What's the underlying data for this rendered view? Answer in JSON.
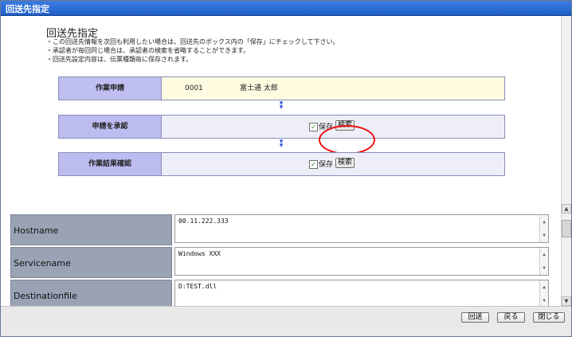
{
  "window": {
    "title": "回送先指定"
  },
  "main": {
    "heading": "回送先指定",
    "notes": [
      "・この回送先情報を次回も利用したい場合は、回送先のボックス内の「保存」にチェックして下さい。",
      "・承認者が毎回同じ場合は、承認者の検索を省略することができます。",
      "・回送先設定内容は、伝票種類毎に保存されます。"
    ],
    "flow": [
      {
        "label": "作業申請",
        "id": "0001",
        "name": "富士通 太郎"
      },
      {
        "label": "申請を承認",
        "save_label": "保存",
        "search_label": "検索",
        "checked": true
      },
      {
        "label": "作業結果確認",
        "save_label": "保存",
        "search_label": "検索",
        "checked": true
      }
    ],
    "arrow_glyph": "❯"
  },
  "fields": [
    {
      "label": "Hostname",
      "value": "00.11.222.333"
    },
    {
      "label": "Servicename",
      "value": "Windows XXX"
    },
    {
      "label": "Destinationfile",
      "value": "D:TEST.dll"
    }
  ],
  "footer": {
    "buttons": [
      "回送",
      "戻る",
      "閉じる"
    ]
  },
  "colors": {
    "titlebar": "#1f5fc9",
    "highlight_circle": "#e11111",
    "flow_label": "#bcbcf0",
    "field_label": "#9aa3b4"
  }
}
